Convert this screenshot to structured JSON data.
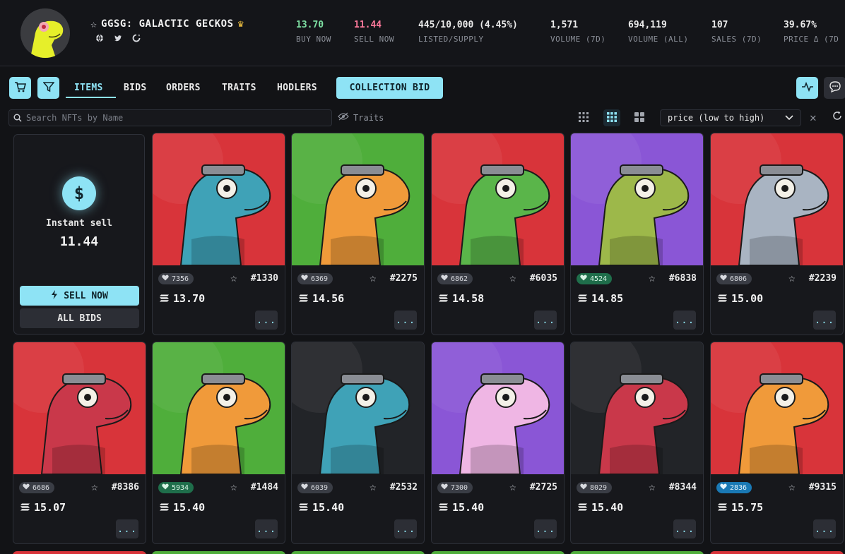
{
  "collection": {
    "title": "GGSG: GALACTIC GECKOS",
    "stats": [
      {
        "value": "13.70",
        "label": "BUY NOW",
        "color": "green"
      },
      {
        "value": "11.44",
        "label": "SELL NOW",
        "color": "pink"
      },
      {
        "value": "445/10,000 (4.45%)",
        "label": "LISTED/SUPPLY",
        "color": ""
      },
      {
        "value": "1,571",
        "label": "VOLUME (7D)",
        "color": ""
      },
      {
        "value": "694,119",
        "label": "VOLUME (ALL)",
        "color": ""
      },
      {
        "value": "107",
        "label": "SALES (7D)",
        "color": ""
      },
      {
        "value": "39.67%",
        "label": "PRICE Δ (7D",
        "color": ""
      }
    ]
  },
  "tabs": [
    "ITEMS",
    "BIDS",
    "ORDERS",
    "TRAITS",
    "HODLERS"
  ],
  "collection_bid_label": "COLLECTION BID",
  "search": {
    "placeholder": "Search NFTs by Name"
  },
  "traits_label": "Traits",
  "sort": {
    "selected": "price (low to high)"
  },
  "sell_card": {
    "label": "Instant sell",
    "value": "11.44",
    "sell_now": "SELL NOW",
    "all_bids": "ALL BIDS"
  },
  "cards": [
    {
      "likes": "7356",
      "id": "#1330",
      "price": "13.70",
      "bg": "#d8343a",
      "body": "#3fa2b7",
      "like_style": "",
      "more": "..."
    },
    {
      "likes": "6369",
      "id": "#2275",
      "price": "14.56",
      "bg": "#4fae3b",
      "body": "#f09a3a",
      "like_style": "",
      "more": "..."
    },
    {
      "likes": "6862",
      "id": "#6035",
      "price": "14.58",
      "bg": "#d8343a",
      "body": "#5ab54a",
      "like_style": "",
      "more": "..."
    },
    {
      "likes": "4524",
      "id": "#6838",
      "price": "14.85",
      "bg": "#8a56d6",
      "body": "#9db84a",
      "like_style": "liked",
      "more": "..."
    },
    {
      "likes": "6806",
      "id": "#2239",
      "price": "15.00",
      "bg": "#d8343a",
      "body": "#a9b4c2",
      "like_style": "",
      "more": "..."
    },
    {
      "likes": "6686",
      "id": "#8386",
      "price": "15.07",
      "bg": "#d8343a",
      "body": "#c9384a",
      "like_style": "",
      "more": "..."
    },
    {
      "likes": "5934",
      "id": "#1484",
      "price": "15.40",
      "bg": "#4fae3b",
      "body": "#f09a3a",
      "like_style": "liked",
      "more": "..."
    },
    {
      "likes": "6039",
      "id": "#2532",
      "price": "15.40",
      "bg": "#222428",
      "body": "#3fa2b7",
      "like_style": "",
      "more": "..."
    },
    {
      "likes": "7300",
      "id": "#2725",
      "price": "15.40",
      "bg": "#8a56d6",
      "body": "#efb6e4",
      "like_style": "",
      "more": "..."
    },
    {
      "likes": "8029",
      "id": "#8344",
      "price": "15.40",
      "bg": "#222428",
      "body": "#c9384a",
      "like_style": "",
      "more": "..."
    },
    {
      "likes": "2836",
      "id": "#9315",
      "price": "15.75",
      "bg": "#d8343a",
      "body": "#f09a3a",
      "like_style": "blue",
      "more": "..."
    }
  ],
  "accent_color": "#8ee3f5"
}
